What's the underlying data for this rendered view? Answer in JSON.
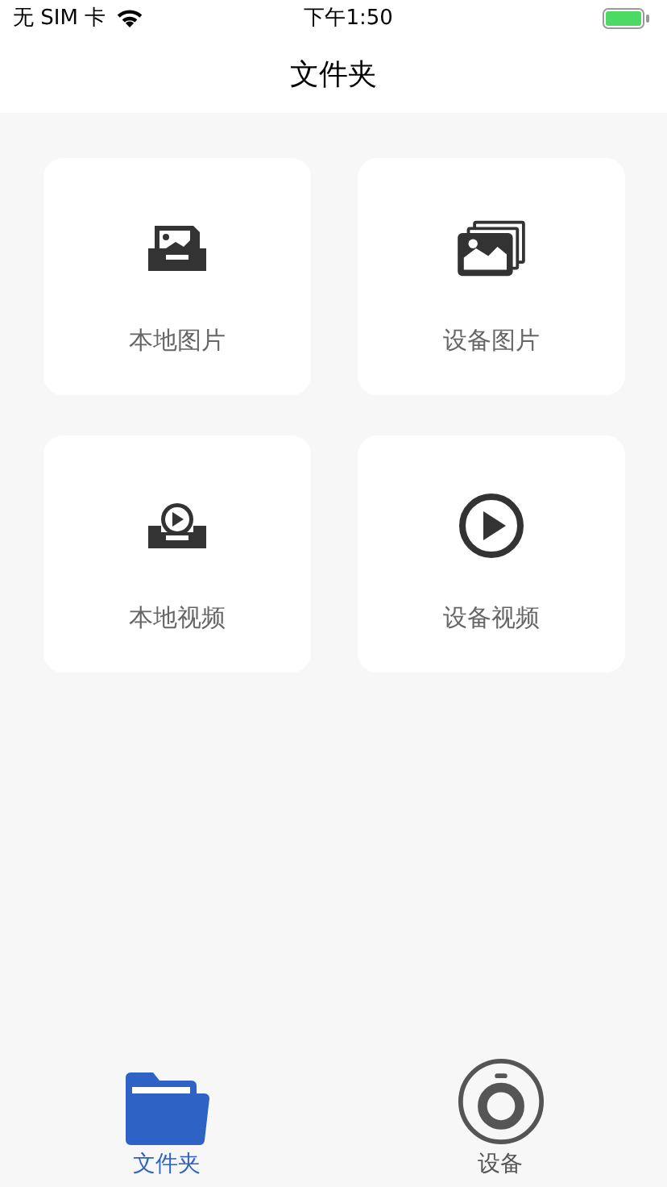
{
  "status_bar": {
    "carrier": "无 SIM 卡",
    "time": "下午1:50"
  },
  "nav_bar": {
    "title": "文件夹"
  },
  "tiles": [
    {
      "kind": "local-photo",
      "label": "本地图片"
    },
    {
      "kind": "device-photo",
      "label": "设备图片"
    },
    {
      "kind": "local-video",
      "label": "本地视频"
    },
    {
      "kind": "device-video",
      "label": "设备视频"
    }
  ],
  "tab_bar": [
    {
      "kind": "folder",
      "label": "文件夹",
      "selected": true
    },
    {
      "kind": "camera",
      "label": "设备",
      "selected": false
    }
  ]
}
